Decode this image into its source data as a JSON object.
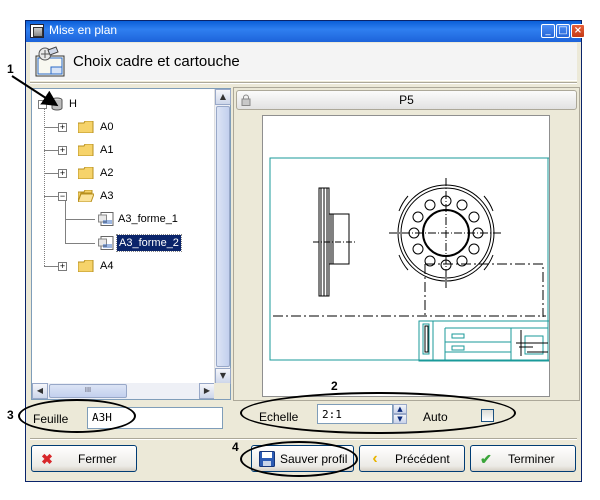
{
  "window": {
    "title": "Mise en plan",
    "minimize_label": "_",
    "maximize_label": "□",
    "close_label": "×"
  },
  "header": {
    "title": "Choix cadre et cartouche"
  },
  "tree": {
    "root": {
      "label": "H",
      "expander": "−"
    },
    "items": [
      {
        "label": "A0",
        "expander": "+",
        "type": "folder"
      },
      {
        "label": "A1",
        "expander": "+",
        "type": "folder"
      },
      {
        "label": "A2",
        "expander": "+",
        "type": "folder"
      },
      {
        "label": "A3",
        "expander": "−",
        "type": "folder-open"
      },
      {
        "label": "A3_forme_1",
        "type": "doc"
      },
      {
        "label": "A3_forme_2",
        "type": "doc",
        "selected": true
      },
      {
        "label": "A4",
        "expander": "+",
        "type": "folder"
      }
    ],
    "hscroll_thumb": "III"
  },
  "preview": {
    "title": "P5"
  },
  "feuille": {
    "label": "Feuille",
    "value": "A3H"
  },
  "echelle": {
    "label": "Echelle",
    "value": "2:1"
  },
  "auto": {
    "label": "Auto",
    "checked": false
  },
  "buttons": {
    "fermer": "Fermer",
    "sauver": "Sauver profil",
    "precedent": "Précédent",
    "terminer": "Terminer"
  },
  "callouts": [
    "1",
    "2",
    "3",
    "4"
  ],
  "colors": {
    "titlebar": "#0a5fd8",
    "drawing_line": "#1a9a9a",
    "selection": "#0a246a"
  }
}
